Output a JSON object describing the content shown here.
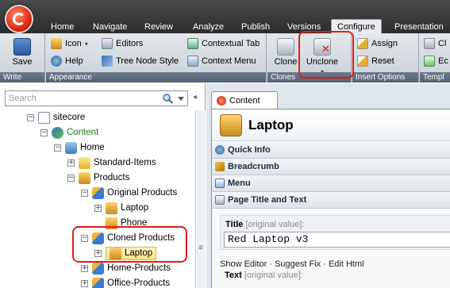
{
  "ribbon": {
    "tabs": [
      "Home",
      "Navigate",
      "Review",
      "Analyze",
      "Publish",
      "Versions",
      "Configure",
      "Presentation"
    ],
    "active_tab": "Configure",
    "groups": {
      "write": {
        "label": "Write",
        "save": "Save"
      },
      "appearance": {
        "label": "Appearance",
        "icon": "Icon",
        "editors": "Editors",
        "contextual_tab": "Contextual Tab",
        "help": "Help",
        "tree_node_style": "Tree Node Style",
        "context_menu": "Context Menu"
      },
      "clones": {
        "label": "Clones",
        "clone": "Clone",
        "unclone": "Unclone"
      },
      "insert_options": {
        "label": "Insert Options",
        "assign": "Assign",
        "reset": "Reset"
      },
      "templates": {
        "label": "Templ",
        "item1": "Cl",
        "item2": "Ec"
      }
    }
  },
  "search": {
    "placeholder": "Search"
  },
  "tree": {
    "items": [
      {
        "label": "sitecore",
        "toggle": "−"
      },
      {
        "label": "Content",
        "toggle": "−"
      },
      {
        "label": "Home",
        "toggle": "−"
      },
      {
        "label": "Standard-Items",
        "toggle": "+"
      },
      {
        "label": "Products",
        "toggle": "−"
      },
      {
        "label": "Original Products",
        "toggle": "−"
      },
      {
        "label": "Laptop",
        "toggle": "+"
      },
      {
        "label": "Phone",
        "toggle": ""
      },
      {
        "label": "Cloned Products",
        "toggle": "−"
      },
      {
        "label": "Laptop",
        "toggle": "+"
      },
      {
        "label": "Home-Products",
        "toggle": "+"
      },
      {
        "label": "Office-Products",
        "toggle": "+"
      }
    ]
  },
  "content": {
    "tab_label": "Content",
    "item_title": "Laptop",
    "sections": [
      "Quick Info",
      "Breadcrumb",
      "Menu",
      "Page Title and Text"
    ],
    "field": {
      "title_label": "Title",
      "title_note": "[original value]:",
      "title_value": "Red Laptop v3"
    },
    "links": "Show Editor · Suggest Fix · Edit Html",
    "text_label": "Text",
    "text_note": "[original value]:"
  },
  "colors": {
    "highlight": "#e31b1b",
    "ribbon_dark": "#2d2d2d",
    "group_label": "#556273"
  }
}
